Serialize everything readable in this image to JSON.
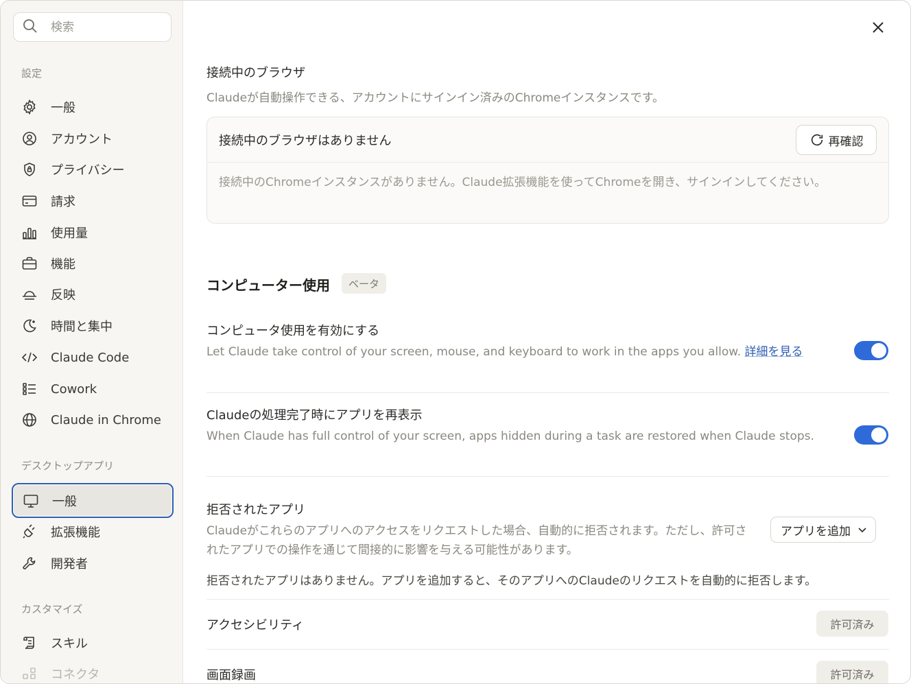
{
  "search": {
    "placeholder": "検索"
  },
  "sidebar": {
    "section_settings": "設定",
    "settings_items": [
      {
        "label": "一般",
        "icon": "gear-icon"
      },
      {
        "label": "アカウント",
        "icon": "account-icon"
      },
      {
        "label": "プライバシー",
        "icon": "shield-icon"
      },
      {
        "label": "請求",
        "icon": "credit-card-icon"
      },
      {
        "label": "使用量",
        "icon": "bar-chart-icon"
      },
      {
        "label": "機能",
        "icon": "briefcase-icon"
      },
      {
        "label": "反映",
        "icon": "sunset-icon"
      },
      {
        "label": "時間と集中",
        "icon": "moon-icon"
      },
      {
        "label": "Claude Code",
        "icon": "code-icon"
      },
      {
        "label": "Cowork",
        "icon": "checklist-icon"
      },
      {
        "label": "Claude in Chrome",
        "icon": "globe-icon"
      }
    ],
    "section_desktop": "デスクトップアプリ",
    "desktop_items": [
      {
        "label": "一般",
        "icon": "monitor-icon",
        "active": true
      },
      {
        "label": "拡張機能",
        "icon": "plug-icon"
      },
      {
        "label": "開発者",
        "icon": "wrench-icon"
      }
    ],
    "section_customize": "カスタマイズ",
    "customize_items": [
      {
        "label": "スキル",
        "icon": "scroll-icon"
      },
      {
        "label": "コネクタ",
        "icon": "connector-icon"
      }
    ]
  },
  "browser": {
    "title": "接続中のブラウザ",
    "description": "Claudeが自動操作できる、アカウントにサインイン済みのChromeインスタンスです。",
    "card_title": "接続中のブラウザはありません",
    "recheck_label": "再確認",
    "card_message": "接続中のChromeインスタンスがありません。Claude拡張機能を使ってChromeを開き、サインインしてください。"
  },
  "computer_use": {
    "title": "コンピューター使用",
    "badge": "ベータ",
    "enable": {
      "title": "コンピュータ使用を有効にする",
      "description": "Let Claude take control of your screen, mouse, and keyboard to work in the apps you allow. ",
      "link": "詳細を見る",
      "enabled": true
    },
    "restore": {
      "title": "Claudeの処理完了時にアプリを再表示",
      "description": "When Claude has full control of your screen, apps hidden during a task are restored when Claude stops.",
      "enabled": true
    },
    "denied": {
      "title": "拒否されたアプリ",
      "description": "Claudeがこれらのアプリへのアクセスをリクエストした場合、自動的に拒否されます。ただし、許可されたアプリでの操作を通じて間接的に影響を与える可能性があります。",
      "add_label": "アプリを追加",
      "empty_message": "拒否されたアプリはありません。アプリを追加すると、そのアプリへのClaudeのリクエストを自動的に拒否します。"
    },
    "permissions": [
      {
        "label": "アクセシビリティ",
        "status": "許可済み"
      },
      {
        "label": "画面録画",
        "status": "許可済み"
      }
    ]
  },
  "colors": {
    "accent": "#2f6ad9",
    "active_border": "#2f5fb3"
  }
}
